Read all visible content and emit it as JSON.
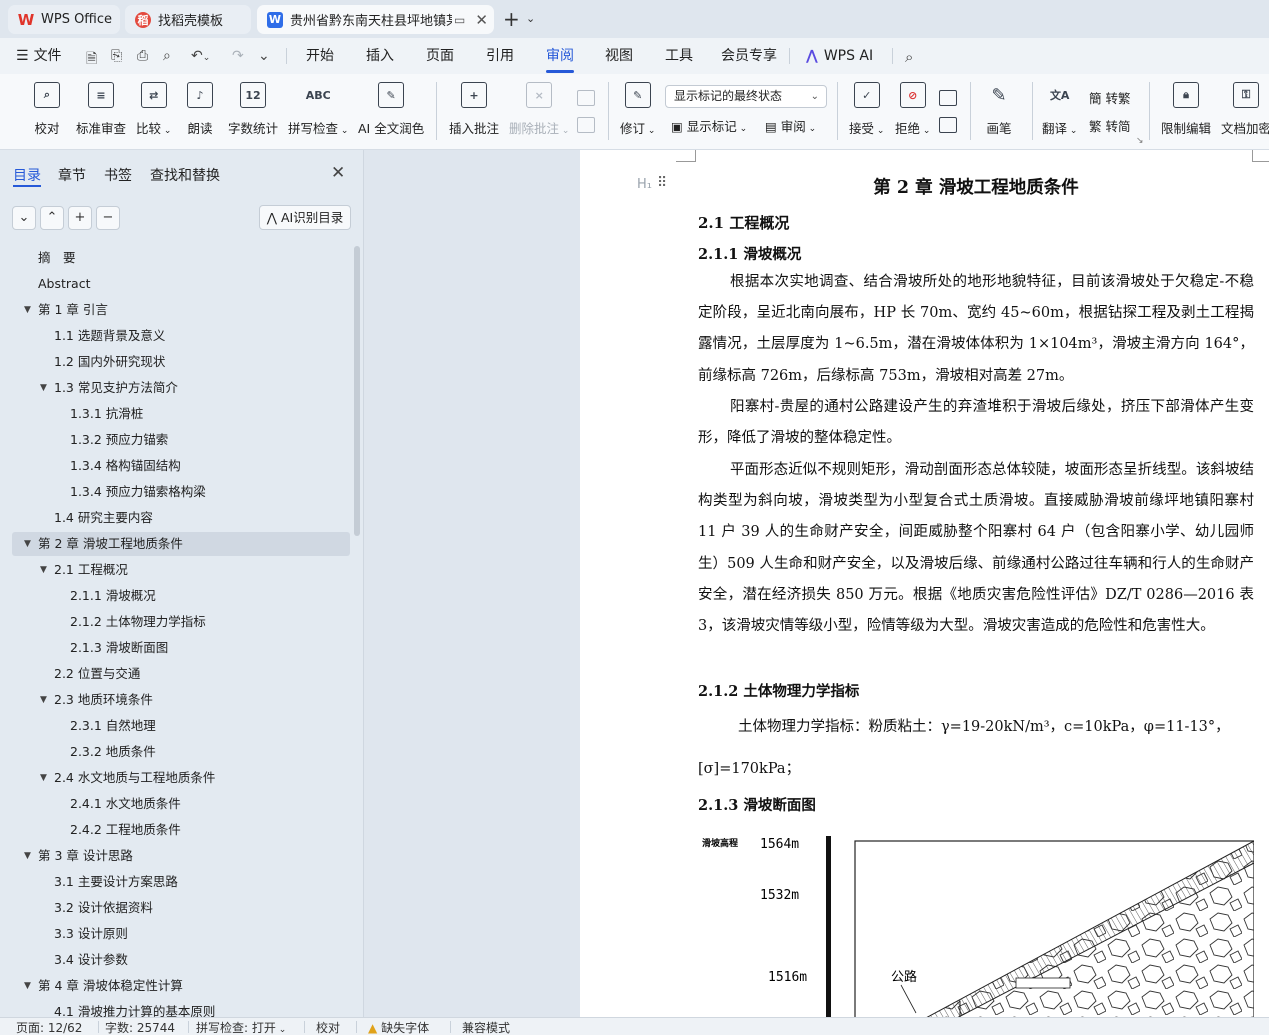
{
  "tabs": {
    "wps": "WPS Office",
    "daoke": "找稻壳模板",
    "doc": "贵州省黔东南天柱县坪地镇某"
  },
  "menu": {
    "file": "文件",
    "items": [
      "开始",
      "插入",
      "页面",
      "引用",
      "审阅",
      "视图",
      "工具",
      "会员专享"
    ],
    "ai": "WPS AI",
    "active": "审阅"
  },
  "ribbon": {
    "proofread": "校对",
    "std_review": "标准审查",
    "compare": "比较",
    "read_aloud": "朗读",
    "word_count": "字数统计",
    "spell_check": "拼写检查",
    "ai_polish": "AI 全文润色",
    "insert_comment": "插入批注",
    "delete_comment": "删除批注",
    "track_changes": "修订",
    "markup_mode": "显示标记的最终状态",
    "show_markup": "显示标记",
    "review_pane": "审阅",
    "accept": "接受",
    "reject": "拒绝",
    "pen": "画笔",
    "translate": "翻译",
    "to_traditional": "转繁",
    "to_simplified": "转简",
    "restrict_edit": "限制编辑",
    "doc_encrypt": "文档加密"
  },
  "nav": {
    "tabs": [
      "目录",
      "章节",
      "书签",
      "查找和替换"
    ],
    "ai_toc": "AI识别目录",
    "items": [
      {
        "label": "摘　要",
        "level": 1,
        "expand": "",
        "selected": false
      },
      {
        "label": "Abstract",
        "level": 1,
        "expand": "",
        "selected": false
      },
      {
        "label": "第 1 章  引言",
        "level": 1,
        "expand": "▼",
        "selected": false
      },
      {
        "label": "1.1 选题背景及意义",
        "level": 2,
        "expand": "",
        "selected": false
      },
      {
        "label": "1.2  国内外研究现状",
        "level": 2,
        "expand": "",
        "selected": false
      },
      {
        "label": "1.3 常见支护方法简介",
        "level": 2,
        "expand": "▼",
        "selected": false
      },
      {
        "label": "1.3.1  抗滑桩",
        "level": 3,
        "expand": "",
        "selected": false
      },
      {
        "label": "1.3.2  预应力锚索",
        "level": 3,
        "expand": "",
        "selected": false
      },
      {
        "label": "1.3.4  格构锚固结构",
        "level": 3,
        "expand": "",
        "selected": false
      },
      {
        "label": "1.3.4  预应力锚索格构梁",
        "level": 3,
        "expand": "",
        "selected": false
      },
      {
        "label": "1.4 研究主要内容",
        "level": 2,
        "expand": "",
        "selected": false
      },
      {
        "label": "第 2 章  滑坡工程地质条件",
        "level": 1,
        "expand": "▼",
        "selected": true
      },
      {
        "label": "2.1  工程概况",
        "level": 2,
        "expand": "▼",
        "selected": false
      },
      {
        "label": "2.1.1  滑坡概况",
        "level": 3,
        "expand": "",
        "selected": false
      },
      {
        "label": "2.1.2  土体物理力学指标",
        "level": 3,
        "expand": "",
        "selected": false
      },
      {
        "label": "2.1.3  滑坡断面图",
        "level": 3,
        "expand": "",
        "selected": false
      },
      {
        "label": "2.2  位置与交通",
        "level": 2,
        "expand": "",
        "selected": false
      },
      {
        "label": "2.3 地质环境条件",
        "level": 2,
        "expand": "▼",
        "selected": false
      },
      {
        "label": "2.3.1 自然地理",
        "level": 3,
        "expand": "",
        "selected": false
      },
      {
        "label": "2.3.2 地质条件",
        "level": 3,
        "expand": "",
        "selected": false
      },
      {
        "label": "2.4 水文地质与工程地质条件",
        "level": 2,
        "expand": "▼",
        "selected": false
      },
      {
        "label": "2.4.1 水文地质条件",
        "level": 3,
        "expand": "",
        "selected": false
      },
      {
        "label": "2.4.2 工程地质条件",
        "level": 3,
        "expand": "",
        "selected": false
      },
      {
        "label": "第 3 章  设计思路",
        "level": 1,
        "expand": "▼",
        "selected": false
      },
      {
        "label": "3.1  主要设计方案思路",
        "level": 2,
        "expand": "",
        "selected": false
      },
      {
        "label": "3.2  设计依据资料",
        "level": 2,
        "expand": "",
        "selected": false
      },
      {
        "label": "3.3 设计原则",
        "level": 2,
        "expand": "",
        "selected": false
      },
      {
        "label": "3.4 设计参数",
        "level": 2,
        "expand": "",
        "selected": false
      },
      {
        "label": "第 4 章  滑坡体稳定性计算",
        "level": 1,
        "expand": "▼",
        "selected": false
      },
      {
        "label": "4.1  滑坡推力计算的基本原则",
        "level": 2,
        "expand": "",
        "selected": false
      }
    ]
  },
  "doc": {
    "h_marker": "H₁",
    "chapter_title": "第 2 章  滑坡工程地质条件",
    "s21": "2.1  工程概况",
    "s211": "2.1.1  滑坡概况",
    "p1": "根据本次实地调查、结合滑坡所处的地形地貌特征，目前该滑坡处于欠稳定-不稳定阶段，呈近北南向展布，HP 长 70m、宽约 45~60m，根据钻探工程及剥土工程揭露情况，土层厚度为 1~6.5m，潜在滑坡体体积为 1×104m³，滑坡主滑方向 164°，前缘标高 726m，后缘标高 753m，滑坡相对高差 27m。",
    "p2": "阳寨村-贵屋的通村公路建设产生的弃渣堆积于滑坡后缘处，挤压下部滑体产生变形，降低了滑坡的整体稳定性。",
    "p3": "平面形态近似不规则矩形，滑动剖面形态总体较陡，坡面形态呈折线型。该斜坡结构类型为斜向坡，滑坡类型为小型复合式土质滑坡。直接威胁滑坡前缘坪地镇阳寨村 11 户 39 人的生命财产安全，间距威胁整个阳寨村 64 户（包含阳寨小学、幼儿园师生）509 人生命和财产安全，以及滑坡后缘、前缘通村公路过往车辆和行人的生命财产安全，潜在经济损失 850 万元。根据《地质灾害危险性评估》DZ/T 0286—2016 表 3，该滑坡灾情等级小型，险情等级为大型。滑坡灾害造成的危险性和危害性大。",
    "s212": "2.1.2  土体物理力学指标",
    "p4_line1": "土体物理力学指标：粉质粘土：γ=19-20kN/m³，c=10kPa，φ=11-13°，",
    "p4_line2": "[σ]=170kPa；",
    "s213": "2.1.3  滑坡断面图",
    "figure": {
      "axis_title": "滑坡高程",
      "labels": [
        "1564m",
        "1532m",
        "1516m"
      ],
      "road_label": "公路"
    }
  },
  "status": {
    "page": "页面: 12/62",
    "words": "字数: 25744",
    "spell": "拼写检查: 打开",
    "proof": "校对",
    "missing_font": "缺失字体",
    "compat": "兼容模式"
  }
}
